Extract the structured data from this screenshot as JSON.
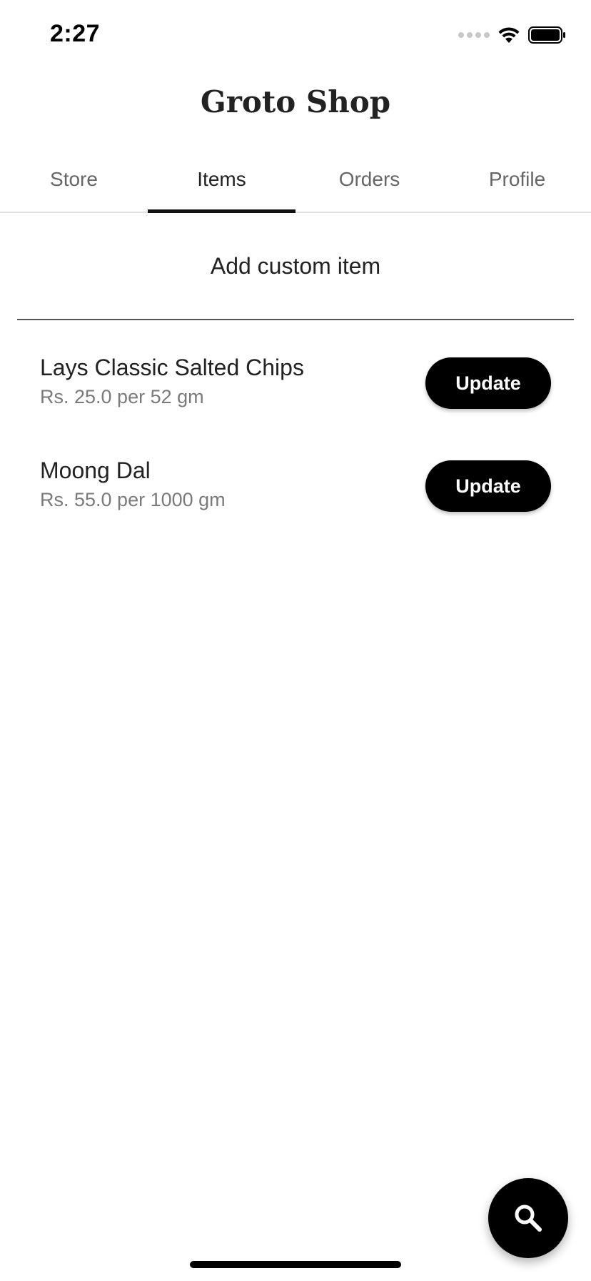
{
  "status_bar": {
    "time": "2:27"
  },
  "app": {
    "title": "Groto Shop"
  },
  "tabs": [
    {
      "label": "Store",
      "active": false
    },
    {
      "label": "Items",
      "active": true
    },
    {
      "label": "Orders",
      "active": false
    },
    {
      "label": "Profile",
      "active": false
    }
  ],
  "add_custom_item": {
    "label": "Add custom item"
  },
  "items": [
    {
      "name": "Lays Classic Salted Chips",
      "price": "Rs. 25.0 per 52 gm",
      "button_label": "Update"
    },
    {
      "name": "Moong Dal",
      "price": "Rs. 55.0 per 1000 gm",
      "button_label": "Update"
    }
  ],
  "fab": {
    "icon": "search-icon"
  },
  "colors": {
    "accent": "#000000",
    "text_primary": "#222222",
    "text_secondary": "#7a7a7a",
    "background": "#ffffff"
  }
}
